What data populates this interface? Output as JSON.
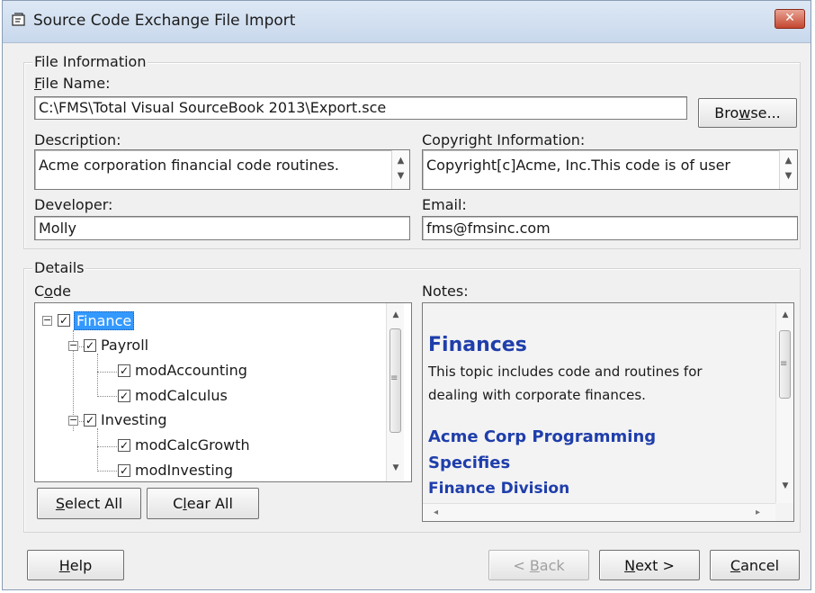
{
  "window": {
    "title": "Source Code Exchange File Import",
    "close_label": "✕"
  },
  "file_info": {
    "legend": "File Information",
    "file_name_label": "File Name:",
    "file_name_value": "C:\\FMS\\Total Visual SourceBook 2013\\Export.sce",
    "browse_label": "Browse...",
    "description_label": "Description:",
    "description_value": "Acme corporation financial code routines.",
    "copyright_label": "Copyright Information:",
    "copyright_value": "Copyright[c]Acme, Inc.This code is of user",
    "developer_label": "Developer:",
    "developer_value": "Molly",
    "email_label": "Email:",
    "email_value": "fms@fmsinc.com"
  },
  "details": {
    "legend": "Details",
    "code_label": "Code",
    "notes_label": "Notes:",
    "tree": [
      {
        "label": "Finance",
        "level": 0,
        "checked": true,
        "selected": true
      },
      {
        "label": "Payroll",
        "level": 1,
        "checked": true
      },
      {
        "label": "modAccounting",
        "level": 2,
        "checked": true
      },
      {
        "label": "modCalculus",
        "level": 2,
        "checked": true
      },
      {
        "label": "Investing",
        "level": 1,
        "checked": true
      },
      {
        "label": "modCalcGrowth",
        "level": 2,
        "checked": true
      },
      {
        "label": "modInvesting",
        "level": 2,
        "checked": true
      }
    ],
    "select_all_label": "Select All",
    "clear_all_label": "Clear All",
    "notes": {
      "heading": "Finances",
      "line1": "This topic includes code and routines for",
      "line2": "dealing with corporate finances.",
      "subheading1": "Acme Corp Programming",
      "subheading2": "Specifies",
      "subheading3": "Finance Division"
    }
  },
  "footer": {
    "help_label": "Help",
    "back_label": "< Back",
    "next_label": "Next >",
    "cancel_label": "Cancel"
  },
  "colors": {
    "selection": "#3399ff",
    "notes_heading": "#1f3eab"
  }
}
